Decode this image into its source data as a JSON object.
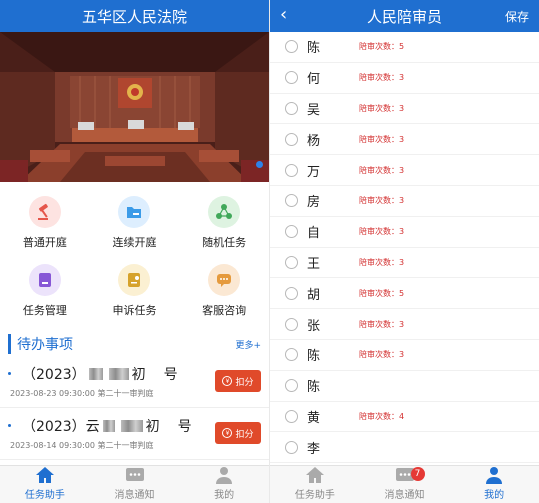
{
  "left": {
    "title": "五华区人民法院",
    "grid": [
      {
        "label": "普通开庭",
        "icon": "gavel-icon",
        "bg": "#fde3e1",
        "fg": "#e5564b"
      },
      {
        "label": "连续开庭",
        "icon": "folder-icon",
        "bg": "#ddeefe",
        "fg": "#3b9be8"
      },
      {
        "label": "随机任务",
        "icon": "share-nodes-icon",
        "bg": "#def3e1",
        "fg": "#41a85a"
      },
      {
        "label": "任务管理",
        "icon": "task-card-icon",
        "bg": "#ece3fb",
        "fg": "#8757d6"
      },
      {
        "label": "申诉任务",
        "icon": "document-icon",
        "bg": "#fbf0d2",
        "fg": "#d6a22b"
      },
      {
        "label": "客服咨询",
        "icon": "chat-bubble-icon",
        "bg": "#fbe8d3",
        "fg": "#e59a3d"
      }
    ],
    "section_title": "待办事项",
    "more": "更多+",
    "todos": [
      {
        "prefix": "（2023）",
        "mid": "初",
        "suffix": "号",
        "time": "2023-08-23 09:30:00",
        "court": "第二十一审判庭",
        "action": "扣分"
      },
      {
        "prefix": "（2023）云",
        "mid": "初",
        "suffix": "号",
        "time": "2023-08-14 09:30:00",
        "court": "第二十一审判庭",
        "action": "扣分"
      }
    ],
    "tabs": [
      {
        "label": "任务助手",
        "active": true
      },
      {
        "label": "消息通知",
        "active": false
      },
      {
        "label": "我的",
        "active": false
      }
    ]
  },
  "right": {
    "title": "人民陪审员",
    "save": "保存",
    "jurors": [
      {
        "name": "陈",
        "count": "陪审次数：5"
      },
      {
        "name": "何",
        "count": "陪审次数：3"
      },
      {
        "name": "吴",
        "count": "陪审次数：3"
      },
      {
        "name": "杨",
        "count": "陪审次数：3"
      },
      {
        "name": "万",
        "count": "陪审次数：3"
      },
      {
        "name": "房",
        "count": "陪审次数：3"
      },
      {
        "name": "自",
        "count": "陪审次数：3"
      },
      {
        "name": "王",
        "count": "陪审次数：3"
      },
      {
        "name": "胡",
        "count": "陪审次数：5"
      },
      {
        "name": "张",
        "count": "陪审次数：3"
      },
      {
        "name": "陈",
        "count": "陪审次数：3"
      },
      {
        "name": "陈",
        "count": ""
      },
      {
        "name": "黄",
        "count": "陪审次数：4"
      },
      {
        "name": "李",
        "count": ""
      }
    ],
    "tabs": [
      {
        "label": "任务助手",
        "active": false
      },
      {
        "label": "消息通知",
        "active": false,
        "badge": "7"
      },
      {
        "label": "我的",
        "active": true
      }
    ]
  },
  "colors": {
    "primary": "#1f6fd0",
    "danger": "#e04a2a"
  }
}
